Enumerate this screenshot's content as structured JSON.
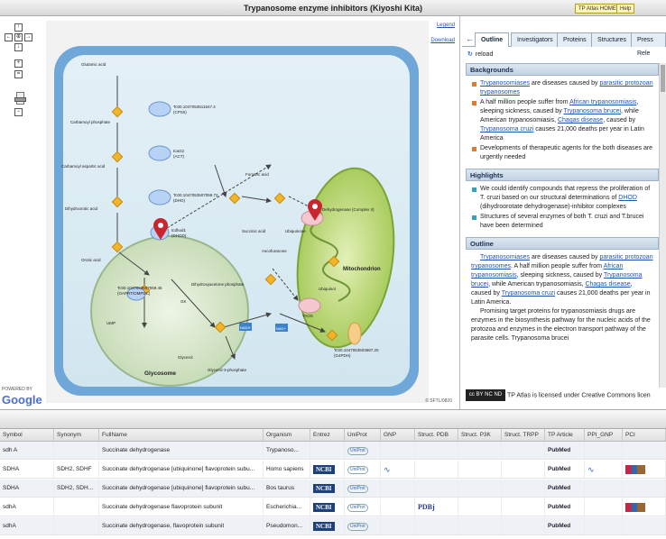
{
  "window": {
    "title": "Trypanosome enzyme inhibitors (Kiyoshi Kita)",
    "btn_home": "TP Atlas HOME",
    "btn_help": "Help"
  },
  "map": {
    "legend": "Legend",
    "download": "Download",
    "powered_by": "POWERED BY",
    "google": "Google",
    "copyright": "© SFTL/0820",
    "labels": {
      "glutamic": "Glutamic acid",
      "carbamoyl": "Carbamoyl phosphate",
      "tc1": "Tc00.1047053511647.4",
      "cpsii": "(CPSII)",
      "tcact": "tcact2",
      "act": "(ACT)",
      "carbaspartic": "Carbamoyl aspartic acid",
      "tc2": "Tc00.1047053507059.72",
      "dho": "(DHO)",
      "dihydroorotic": "Dihydroorotic acid",
      "tcdhod": "tcdhod1",
      "dhod": "(DHOD)",
      "orotic": "Orotic acid",
      "tc3": "Tc00.1047053507059.45",
      "daph": "(OAPRT/OMPDC)",
      "ump": "UMP",
      "glycosome": "Glycosome",
      "fumaric": "Fumaric acid",
      "succinic": "Succinic acid",
      "dihydroxy": "Dihydroxyacetone phosphate",
      "glycerol": "Glycerol",
      "g3p": "Glycerol-3-phosphate",
      "ubiquinone": "Ubiquinone",
      "ascofuranone": "Ascofuranone",
      "ubiquinol": "Ubiquinol",
      "mito": "Mitochondrion",
      "taos": "TAOS",
      "dehydrogenase": "Dehydrogenase (Complex II)",
      "tc4": "Tc00.1047053503687.20",
      "gapdh": "(G4PDH)",
      "nadh": "NADH",
      "nad": "NAD+",
      "gk": "GK"
    }
  },
  "panel": {
    "tabs": [
      "Outline",
      "Investigators",
      "Proteins",
      "Structures",
      "Press Rele"
    ],
    "reload": "reload",
    "backgrounds": {
      "heading": "Backgrounds",
      "items": [
        [
          {
            "t": "Trypanosomiases",
            "l": 1
          },
          {
            "t": " are diseases caused by "
          },
          {
            "t": "parasitic protozoan",
            "l": 1
          },
          {
            "t": " "
          },
          {
            "t": "trypanosomes",
            "l": 1
          }
        ],
        [
          {
            "t": "A half million people suffer from "
          },
          {
            "t": "African trypanosomiasis",
            "l": 1
          },
          {
            "t": ", sleeping sickness, caused by "
          },
          {
            "t": "Trypanosoma brucei",
            "l": 1
          },
          {
            "t": ", while American trypanosomiasis, "
          },
          {
            "t": "Chagas disease",
            "l": 1
          },
          {
            "t": ", caused by "
          },
          {
            "t": "Trypanosoma cruzi",
            "l": 1
          },
          {
            "t": " causes 21,000 deaths per year in Latin America"
          }
        ],
        [
          {
            "t": "Developments of therapeutic agents for the both diseases are urgently needed"
          }
        ]
      ]
    },
    "highlights": {
      "heading": "Highlights",
      "items": [
        [
          {
            "t": "We could identify compounds that repress the proliferation of T. cruzi based on our structural determinations of "
          },
          {
            "t": "DHOD",
            "l": 1
          },
          {
            "t": " (dihydroorotate dehydrogenase)-inhibitor complexes"
          }
        ],
        [
          {
            "t": "Structures of several enzymes of both T. cruzi and T.brucei have been determined"
          }
        ]
      ]
    },
    "outline": {
      "heading": "Outline",
      "p1": [
        {
          "t": "Trypanosomiases",
          "l": 1
        },
        {
          "t": " are diseases caused by "
        },
        {
          "t": "parasitic protozoan",
          "l": 1
        },
        {
          "t": " "
        },
        {
          "t": "trypanosomes",
          "l": 1
        },
        {
          "t": ". A half million people suffer from "
        },
        {
          "t": "African trypanosomiasis",
          "l": 1
        },
        {
          "t": ", sleeping sickness, caused by "
        },
        {
          "t": "Trypanosoma brucei",
          "l": 1
        },
        {
          "t": ", while American trypanosomiasis, "
        },
        {
          "t": "Chagas disease",
          "l": 1
        },
        {
          "t": ", caused by "
        },
        {
          "t": "Trypanosoma cruzi",
          "l": 1
        },
        {
          "t": " causes 21,000 deaths per year in Latin America."
        }
      ],
      "p2": "Promising target proteins for trypanosomiasis drugs are enzymes in the biosynthesis pathway for the nucleic acids of the protozoa and enzymes in the electron transport pathway of the parasite cells. Trypanosoma brucei"
    },
    "license": "TP Atlas is licensed under Creative Commons licen",
    "cc_badge": "cc BY NC ND"
  },
  "table": {
    "columns": [
      "Symbol",
      "Synonym",
      "FullName",
      "Organism",
      "Entrez",
      "UniProt",
      "GNP",
      "Struct. PDB",
      "Struct. P3K",
      "Struct. TRPP",
      "TP Article",
      "PPI_GNP",
      "PCI"
    ],
    "rows": [
      {
        "symbol": "sdh A",
        "synonym": "",
        "fullname": "Succinate dehydrogenase",
        "organism": "Trypanoso...",
        "entrez": "",
        "uniprot": "UniProt",
        "gnp": "",
        "pdb": "",
        "article": "PubMed",
        "ppi": "",
        "pci": ""
      },
      {
        "symbol": "SDHA",
        "synonym": "SDH2, SDHF",
        "fullname": "Succinate dehydrogenase [ubiquinone] flavoprotein subu...",
        "organism": "Homo sapiens",
        "entrez": "NCBI",
        "uniprot": "UniProt",
        "gnp": "∿",
        "pdb": "",
        "article": "PubMed",
        "ppi": "∿",
        "pci": "img"
      },
      {
        "symbol": "SDHA",
        "synonym": "SDH2, SDH...",
        "fullname": "Succinate dehydrogenase [ubiquinone] flavoprotein subu...",
        "organism": "Bos taurus",
        "entrez": "NCBI",
        "uniprot": "UniProt",
        "gnp": "",
        "pdb": "",
        "article": "PubMed",
        "ppi": "",
        "pci": ""
      },
      {
        "symbol": "sdhA",
        "synonym": "",
        "fullname": "Succinate dehydrogenase flavoprotein subunit",
        "organism": "Escherichia...",
        "entrez": "NCBI",
        "uniprot": "UniProt",
        "gnp": "",
        "pdb": "PDBj",
        "article": "PubMed",
        "ppi": "",
        "pci": "img"
      },
      {
        "symbol": "sdhA",
        "synonym": "",
        "fullname": "Succinate dehydrogenase, flavoprotein subunit",
        "organism": "Pseudomon...",
        "entrez": "NCBI",
        "uniprot": "UniProt",
        "gnp": "",
        "pdb": "",
        "article": "PubMed",
        "ppi": "",
        "pci": ""
      }
    ]
  }
}
